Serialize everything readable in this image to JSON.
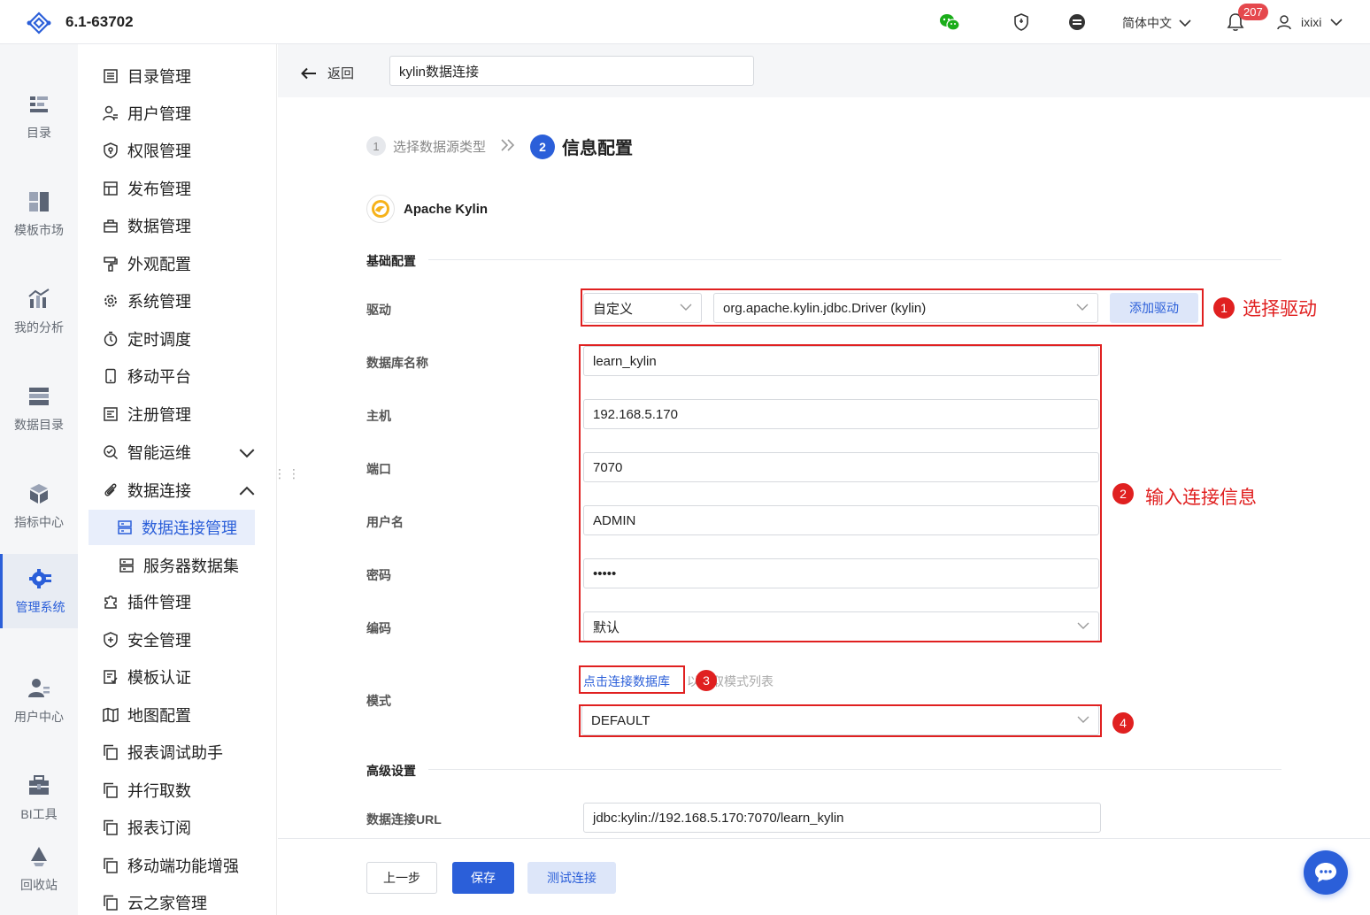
{
  "topbar": {
    "version": "6.1-63702",
    "language": "简体中文",
    "notification_count": "207",
    "username": "ixixi"
  },
  "rail": [
    {
      "label": "目录",
      "icon": "catalog-icon"
    },
    {
      "label": "模板市场",
      "icon": "template-market-icon"
    },
    {
      "label": "我的分析",
      "icon": "analysis-icon"
    },
    {
      "label": "数据目录",
      "icon": "data-catalog-icon"
    },
    {
      "label": "指标中心",
      "icon": "metrics-icon"
    },
    {
      "label": "管理系统",
      "icon": "management-icon"
    },
    {
      "label": "用户中心",
      "icon": "user-center-icon"
    },
    {
      "label": "BI工具",
      "icon": "bi-tools-icon"
    },
    {
      "label": "回收站",
      "icon": "recycle-icon"
    }
  ],
  "menu": [
    {
      "label": "目录管理"
    },
    {
      "label": "用户管理"
    },
    {
      "label": "权限管理"
    },
    {
      "label": "发布管理"
    },
    {
      "label": "数据管理"
    },
    {
      "label": "外观配置"
    },
    {
      "label": "系统管理"
    },
    {
      "label": "定时调度"
    },
    {
      "label": "移动平台"
    },
    {
      "label": "注册管理"
    },
    {
      "label": "智能运维"
    },
    {
      "label": "数据连接"
    },
    {
      "label": "数据连接管理"
    },
    {
      "label": "服务器数据集"
    },
    {
      "label": "插件管理"
    },
    {
      "label": "安全管理"
    },
    {
      "label": "模板认证"
    },
    {
      "label": "地图配置"
    },
    {
      "label": "报表调试助手"
    },
    {
      "label": "并行取数"
    },
    {
      "label": "报表订阅"
    },
    {
      "label": "移动端功能增强"
    },
    {
      "label": "云之家管理"
    }
  ],
  "header": {
    "back_label": "返回",
    "connection_name": "kylin数据连接"
  },
  "steps": {
    "step1_num": "1",
    "step1_label": "选择数据源类型",
    "step2_num": "2",
    "step2_label": "信息配置"
  },
  "datasource": {
    "name": "Apache Kylin"
  },
  "basic": {
    "section_title": "基础配置",
    "driver_label": "驱动",
    "driver_type": "自定义",
    "driver_class": "org.apache.kylin.jdbc.Driver (kylin)",
    "add_driver_label": "添加驱动",
    "db_name_label": "数据库名称",
    "db_name": "learn_kylin",
    "host_label": "主机",
    "host": "192.168.5.170",
    "port_label": "端口",
    "port": "7070",
    "user_label": "用户名",
    "user": "ADMIN",
    "password_label": "密码",
    "password": "•••••",
    "encoding_label": "编码",
    "encoding": "默认",
    "schema_label": "模式",
    "connect_link": "点击连接数据库",
    "connect_hint": "以获取模式列表",
    "schema": "DEFAULT"
  },
  "advanced": {
    "section_title": "高级设置",
    "url_label": "数据连接URL",
    "url": "jdbc:kylin://192.168.5.170:7070/learn_kylin"
  },
  "annotations": {
    "n1": "1",
    "t1": "选择驱动",
    "n2": "2",
    "t2": "输入连接信息",
    "n3": "3",
    "n4": "4"
  },
  "buttons": {
    "prev": "上一步",
    "save": "保存",
    "test": "测试连接"
  },
  "colors": {
    "accent": "#2b5fd9",
    "annotation": "#e02020"
  }
}
